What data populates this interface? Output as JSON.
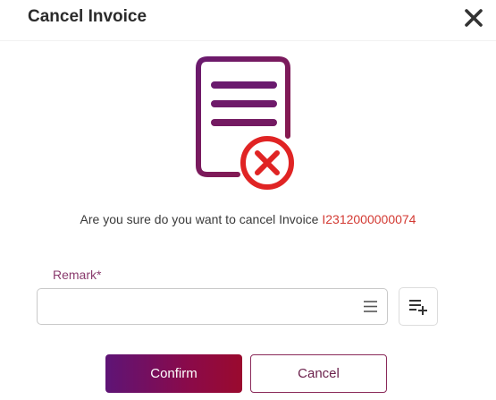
{
  "dialog": {
    "title": "Cancel Invoice",
    "close_icon": "close-icon"
  },
  "illustration": {
    "icon": "document-cancel-icon",
    "colors": {
      "document": "#7a1a5e",
      "cancel_ring": "#e02424"
    }
  },
  "message": {
    "prefix": "Are you sure do you want to cancel Invoice ",
    "invoice_number": "I2312000000074"
  },
  "remark": {
    "label": "Remark*",
    "value": "",
    "placeholder": "",
    "menu_icon": "list-icon",
    "add_icon": "playlist-add-icon"
  },
  "actions": {
    "confirm_label": "Confirm",
    "cancel_label": "Cancel"
  },
  "colors": {
    "accent_start": "#5e1476",
    "accent_end": "#9a0a2e",
    "invoice_text": "#d33a33",
    "label": "#8a3b6d"
  }
}
